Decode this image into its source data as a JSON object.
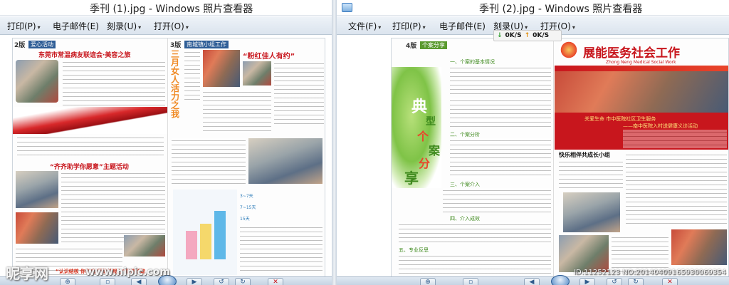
{
  "windows": {
    "left": {
      "title": "季刊 (1).jpg - Windows 照片查看器",
      "menu": [
        {
          "label": "打印(P)",
          "caret": "▾"
        },
        {
          "label": "电子邮件(E)",
          "caret": ""
        },
        {
          "label": "刻录(U)",
          "caret": "▾"
        },
        {
          "label": "打开(O)",
          "caret": "▾"
        }
      ],
      "doc": {
        "page2": {
          "page_label": "2版",
          "section": "爱心活动",
          "headline": "东莞市常温病友联谊会·美容之旅",
          "article2_title": "“齐齐助学你愿意”主题活动",
          "caption": "“认识结核 你有病 拒绝歧视心”宣传活动"
        },
        "page3": {
          "page_label": "3版",
          "section": "南城镇小组工作",
          "vertical_title": "三月女人 活力之我",
          "headline": "“粉红佳人有约”",
          "chart_labels": [
            "3~7天",
            "7~15天",
            "15天"
          ]
        }
      }
    },
    "right": {
      "title": "季刊 (2).jpg - Windows 照片查看器",
      "menu": [
        {
          "label": "文件(F)",
          "caret": "▾"
        },
        {
          "label": "打印(P)",
          "caret": "▾"
        },
        {
          "label": "电子邮件(E)",
          "caret": ""
        },
        {
          "label": "刻录(U)",
          "caret": "▾"
        },
        {
          "label": "打开(O)",
          "caret": "▾"
        }
      ],
      "speed": {
        "down": "0K/S",
        "up": "0K/S"
      },
      "doc": {
        "page4": {
          "page_label": "4版",
          "section": "个案分享",
          "vertical_title": [
            "典",
            "型",
            "个",
            "案",
            "分",
            "享"
          ],
          "headings": [
            "一、个案的基本情况",
            "二、个案分析",
            "三、个案介入",
            "四、介入成效",
            "五、专业反思"
          ]
        },
        "page5": {
          "org_title": "展能医务社会工作",
          "org_subtitle": "Zhong Neng Medical Social Work",
          "feature": "关爱生命 市中医院社区卫生服务",
          "feature2": "——南中医院入村送健康义诊活动",
          "group_title": "快乐相伴共成长小组"
        }
      }
    }
  },
  "watermark": {
    "site": "昵享网",
    "url": "www.nipic.com",
    "id": "ID:11252123 NO:20140409165930069354"
  },
  "colors": {
    "brand_red": "#c8161d",
    "sect_blue": "#2e5d96",
    "leaf_green": "#7fc347"
  }
}
